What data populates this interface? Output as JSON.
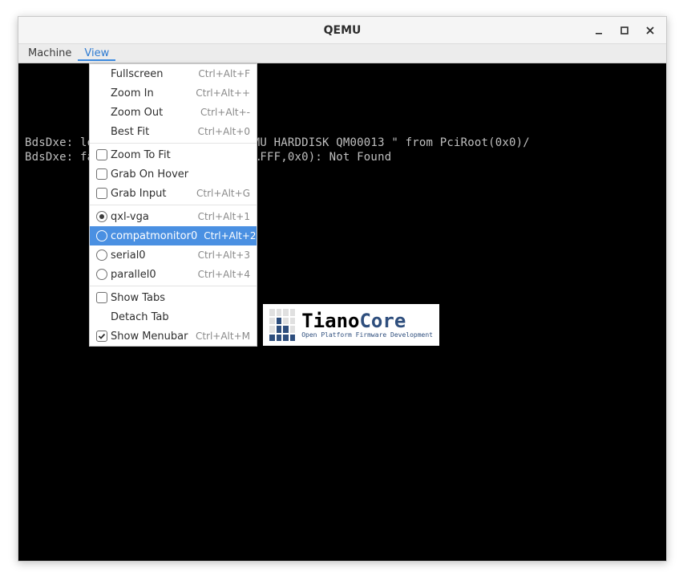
{
  "window": {
    "title": "QEMU"
  },
  "menubar": {
    "items": [
      {
        "label": "Machine"
      },
      {
        "label": "View"
      }
    ],
    "open_index": 1
  },
  "view_menu": {
    "sections": [
      [
        {
          "kind": "plain",
          "label": "Fullscreen",
          "shortcut": "Ctrl+Alt+F"
        },
        {
          "kind": "plain",
          "label": "Zoom In",
          "shortcut": "Ctrl+Alt++"
        },
        {
          "kind": "plain",
          "label": "Zoom Out",
          "shortcut": "Ctrl+Alt+-"
        },
        {
          "kind": "plain",
          "label": "Best Fit",
          "shortcut": "Ctrl+Alt+0"
        }
      ],
      [
        {
          "kind": "check",
          "checked": false,
          "label": "Zoom To Fit",
          "shortcut": ""
        },
        {
          "kind": "check",
          "checked": false,
          "label": "Grab On Hover",
          "shortcut": ""
        },
        {
          "kind": "check",
          "checked": false,
          "label": "Grab Input",
          "shortcut": "Ctrl+Alt+G"
        }
      ],
      [
        {
          "kind": "radio",
          "selected": true,
          "highlight": false,
          "label": "qxl-vga",
          "shortcut": "Ctrl+Alt+1"
        },
        {
          "kind": "radio",
          "selected": false,
          "highlight": true,
          "label": "compatmonitor0",
          "shortcut": "Ctrl+Alt+2"
        },
        {
          "kind": "radio",
          "selected": false,
          "highlight": false,
          "label": "serial0",
          "shortcut": "Ctrl+Alt+3"
        },
        {
          "kind": "radio",
          "selected": false,
          "highlight": false,
          "label": "parallel0",
          "shortcut": "Ctrl+Alt+4"
        }
      ],
      [
        {
          "kind": "check",
          "checked": false,
          "label": "Show Tabs",
          "shortcut": ""
        },
        {
          "kind": "plain",
          "label": "Detach Tab",
          "shortcut": ""
        },
        {
          "kind": "check",
          "checked": true,
          "label": "Show Menubar",
          "shortcut": "Ctrl+Alt+M"
        }
      ]
    ]
  },
  "terminal": {
    "line1": "BdsDxe: loading Boot0001 \"UEFI QEMU HARDDISK QM00013 \" from PciRoot(0x0)/",
    "line2": "BdsDxe: failed to load Boot0001 (…FFF,0x0): Not Found"
  },
  "tianocore": {
    "brand_left": "Tiano",
    "brand_right": "Core",
    "subtitle": "Open Platform Firmware Development"
  }
}
